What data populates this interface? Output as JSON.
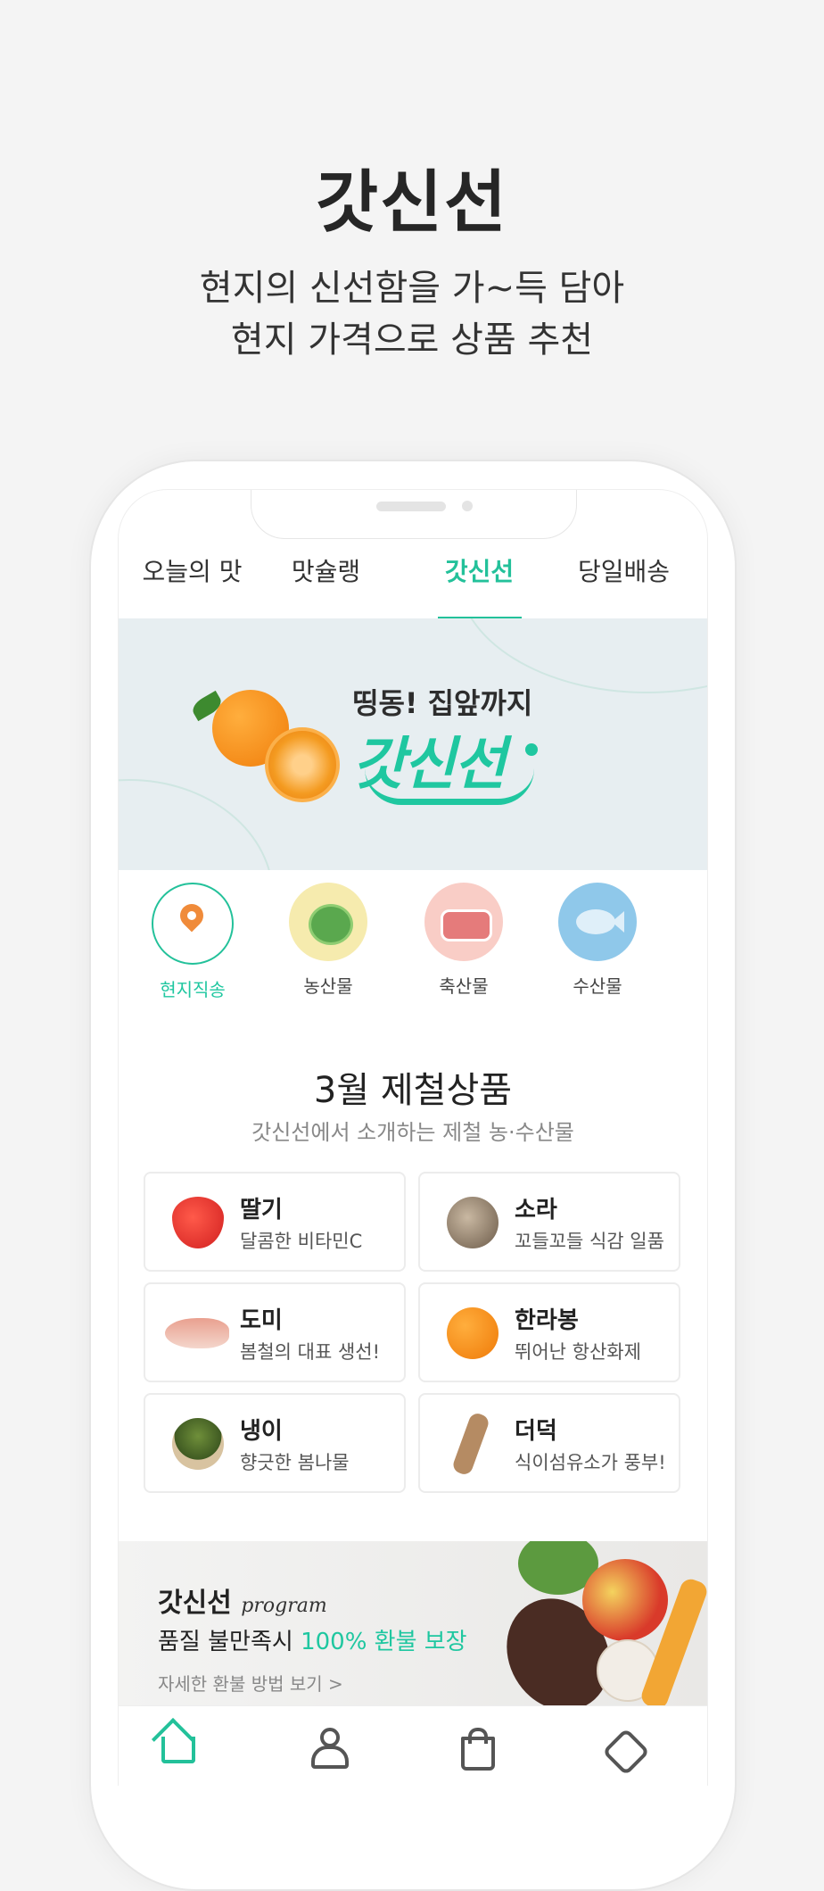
{
  "hero": {
    "title": "갓신선",
    "subtitle_line1": "현지의 신선함을 가~득 담아",
    "subtitle_line2": "현지 가격으로 상품 추천"
  },
  "tabs": [
    {
      "label": "오늘의 맛",
      "active": false
    },
    {
      "label": "맛슐랭",
      "active": false
    },
    {
      "label": "갓신선",
      "active": true
    },
    {
      "label": "당일배송",
      "active": false
    }
  ],
  "banner": {
    "headline": "띵동! 집앞까지",
    "logo_text": "갓신선"
  },
  "categories": [
    {
      "label": "현지직송",
      "icon": "location-pin-icon",
      "active": true
    },
    {
      "label": "농산물",
      "icon": "cabbage-icon",
      "active": false
    },
    {
      "label": "축산물",
      "icon": "meat-icon",
      "active": false
    },
    {
      "label": "수산물",
      "icon": "fish-icon",
      "active": false
    }
  ],
  "seasonal": {
    "title": "3월 제철상품",
    "subtitle": "갓신선에서 소개하는 제철 농·수산물",
    "items": [
      {
        "name": "딸기",
        "desc": "달콤한 비타민C",
        "icon": "strawberry-icon"
      },
      {
        "name": "소라",
        "desc": "꼬들꼬들 식감 일품",
        "icon": "conch-icon"
      },
      {
        "name": "도미",
        "desc": "봄철의 대표 생선!",
        "icon": "sea-bream-icon"
      },
      {
        "name": "한라봉",
        "desc": "뛰어난 항산화제",
        "icon": "hallabong-icon"
      },
      {
        "name": "냉이",
        "desc": "향긋한 봄나물",
        "icon": "shepherds-purse-icon"
      },
      {
        "name": "더덕",
        "desc": "식이섬유소가 풍부!",
        "icon": "deodeok-root-icon"
      }
    ]
  },
  "promo": {
    "title": "갓신선",
    "script": "program",
    "line_prefix": "품질 불만족시 ",
    "line_accent": "100% 환불 보장",
    "link": "자세한 환불 방법 보기 >"
  },
  "bottom_nav": [
    {
      "icon": "home-icon",
      "active": true
    },
    {
      "icon": "person-icon",
      "active": false
    },
    {
      "icon": "shopping-bag-icon",
      "active": false
    },
    {
      "icon": "heart-check-icon",
      "active": false
    }
  ],
  "colors": {
    "accent": "#23c19a",
    "background": "#f4f4f4",
    "text": "#222222"
  }
}
